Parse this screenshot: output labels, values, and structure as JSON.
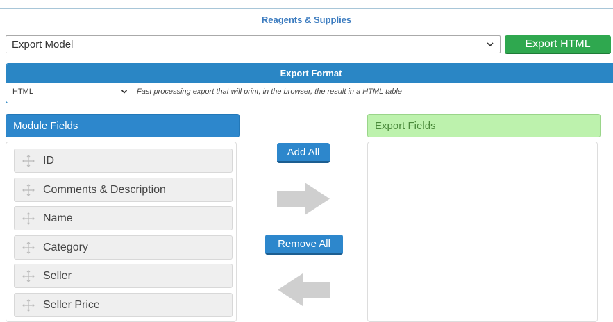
{
  "header": {
    "title": "Reagents & Supplies"
  },
  "export_model": {
    "value": "Export Model",
    "icon": "chevron-down-icon"
  },
  "export_button": {
    "label": "Export HTML",
    "color": "#2fa84f"
  },
  "export_format": {
    "title": "Export Format",
    "selected": "HTML",
    "description": "Fast processing export that will print, in the browser, the result in a HTML table"
  },
  "module_fields": {
    "title": "Module Fields",
    "items": [
      "ID",
      "Comments & Description",
      "Name",
      "Category",
      "Seller",
      "Seller Price"
    ]
  },
  "export_fields": {
    "title": "Export Fields",
    "items": []
  },
  "actions": {
    "add_all": "Add All",
    "remove_all": "Remove All",
    "move_right_icon": "arrow-right-icon",
    "move_left_icon": "arrow-left-icon"
  },
  "colors": {
    "accent": "#2d87cc",
    "export_head": "#bdf2ad",
    "success": "#2fa84f"
  }
}
